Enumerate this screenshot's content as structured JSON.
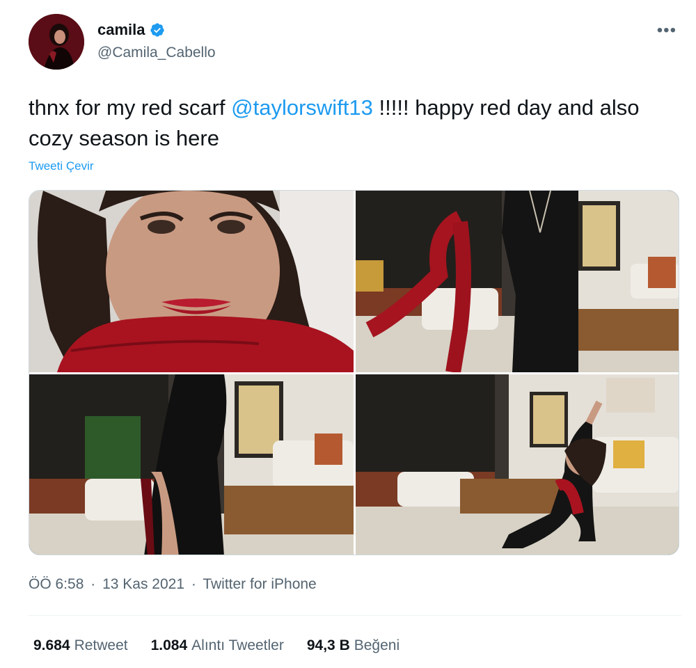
{
  "author": {
    "display_name": "camila",
    "handle": "@Camila_Cabello",
    "verified": true
  },
  "tweet": {
    "text_before": "thnx for my red scarf ",
    "mention": "@taylorswift13",
    "text_after": " !!!!! happy red day and also cozy season is here",
    "translate_label": "Tweeti Çevir"
  },
  "media": [
    {
      "name": "selfie-red-scarf-photo"
    },
    {
      "name": "holding-red-scarf-photo"
    },
    {
      "name": "black-dress-photo"
    },
    {
      "name": "dancing-photo"
    }
  ],
  "meta": {
    "time": "ÖÖ 6:58",
    "separator": "·",
    "date": "13 Kas 2021",
    "source": "Twitter for iPhone"
  },
  "stats": {
    "retweets_count": "9.684",
    "retweets_label": "Retweet",
    "quotes_count": "1.084",
    "quotes_label": "Alıntı Tweetler",
    "likes_count": "94,3 B",
    "likes_label": "Beğeni"
  },
  "colors": {
    "link": "#1d9bf0",
    "secondary_text": "#536471",
    "primary_text": "#0f1419"
  },
  "icons": {
    "verified": "verified-badge-icon",
    "more": "more-options-icon"
  }
}
